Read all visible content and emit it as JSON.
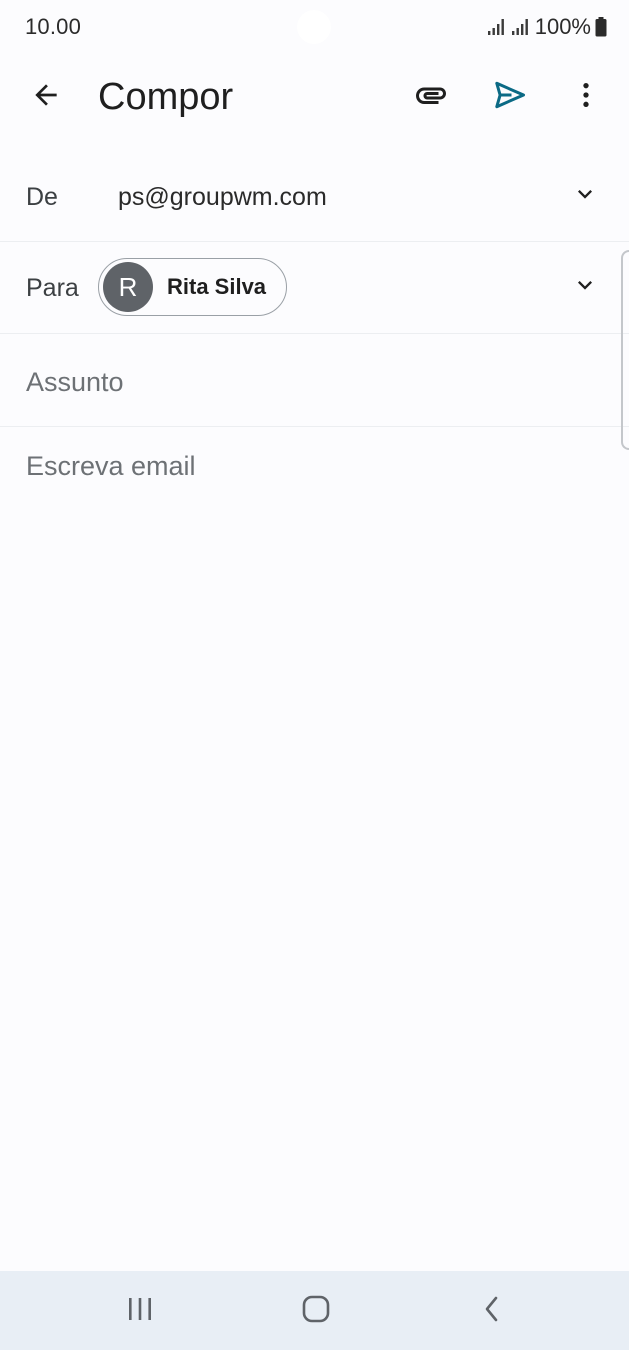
{
  "status_bar": {
    "time": "10.00",
    "battery": "100%"
  },
  "toolbar": {
    "title": "Compor",
    "icons": {
      "back": "arrow-back-icon",
      "attach": "paperclip-icon",
      "send": "send-icon",
      "more": "more-vert-icon"
    },
    "send_color": "#0b6a85"
  },
  "form": {
    "from": {
      "label": "De",
      "value": "ps@groupwm.com"
    },
    "to": {
      "label": "Para",
      "recipient": {
        "initial": "R",
        "name": "Rita Silva"
      }
    },
    "subject": {
      "placeholder": "Assunto",
      "value": ""
    },
    "body": {
      "placeholder": "Escreva email",
      "value": ""
    }
  },
  "nav_bar": {
    "icons": [
      "recents-icon",
      "home-icon",
      "back-icon"
    ]
  }
}
